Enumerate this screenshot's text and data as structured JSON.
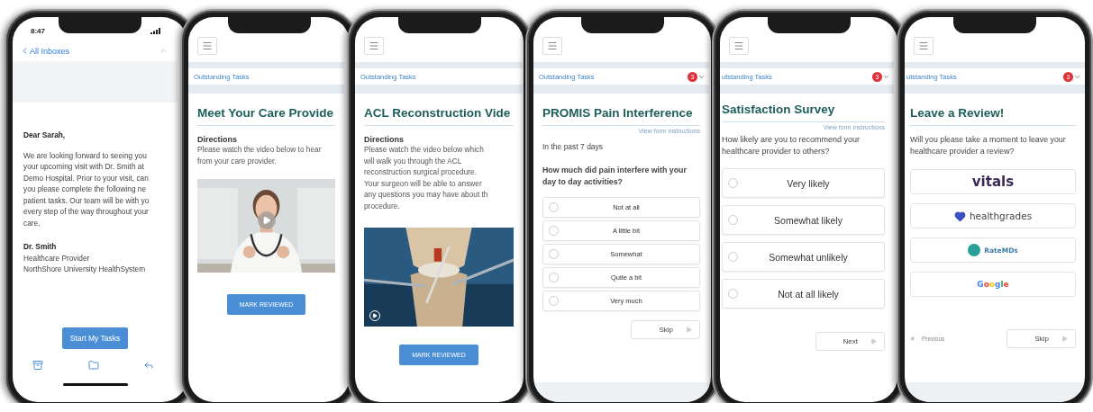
{
  "phones": [
    {
      "kind": "email",
      "status_time": "8:47",
      "back_label": "All Inboxes",
      "greeting": "Dear Sarah,",
      "body_lines": [
        "We are looking forward to seeing you",
        "your upcoming visit with Dr. Smith at",
        "Demo Hospital. Prior to your visit, can",
        "you please complete the following ne",
        "patient tasks. Our team will be with yo",
        "every step of the way throughout your",
        "care."
      ],
      "signature": [
        "Dr. Smith",
        "Healthcare Provider",
        "NorthShore University HealthSystem"
      ],
      "button": "Start My Tasks"
    },
    {
      "kind": "video",
      "breadcrumb": "Outstanding Tasks",
      "title": "Meet Your Care Provide",
      "directions_label": "Directions",
      "directions": [
        "Please watch the video below to hear",
        "from your care provider."
      ],
      "button": "MARK REVIEWED"
    },
    {
      "kind": "video",
      "breadcrumb": "Outstanding Tasks",
      "title": "ACL Reconstruction Vide",
      "directions_label": "Directions",
      "directions": [
        "Please watch the video below which",
        "will walk you through the ACL",
        "reconstruction surgical procedure.",
        "Your surgeon will be able to answer",
        "any questions you may have about th",
        "procedure."
      ],
      "button": "MARK REVIEWED"
    },
    {
      "kind": "survey",
      "breadcrumb": "Outstanding Tasks",
      "badge": "3",
      "title": "PROMIS Pain Interference",
      "instructions_link": "View form instructions",
      "subtitle": "In the past 7 days",
      "question": "How much did pain interfere with your day to day activities?",
      "options": [
        {
          "label": "Not at all",
          "selected": false
        },
        {
          "label": "A little bit",
          "selected": false
        },
        {
          "label": "Somewhat",
          "selected": false
        },
        {
          "label": "Quite a bit",
          "selected": false
        },
        {
          "label": "Very much",
          "selected": false
        }
      ],
      "next_button": "Skip"
    },
    {
      "kind": "rating",
      "breadcrumb": "utstanding Tasks",
      "badge": "3",
      "title": "Satisfaction Survey",
      "instructions_link": "View form instructions",
      "question": "How likely are you to recommend your healthcare provider to others?",
      "options": [
        {
          "label": "Very likely",
          "selected": false
        },
        {
          "label": "Somewhat likely",
          "selected": false
        },
        {
          "label": "Somewhat unlikely",
          "selected": false
        },
        {
          "label": "Not at all likely",
          "selected": false
        }
      ],
      "next_button": "Next"
    },
    {
      "kind": "review",
      "breadcrumb": "utstanding Tasks",
      "badge": "3",
      "title": "Leave a Review!",
      "prompt": "Will you please take a moment to leave your healthcare provider a review?",
      "sites": [
        {
          "kind": "vitals",
          "label": "vitals"
        },
        {
          "kind": "healthgrades",
          "label": "healthgrades"
        },
        {
          "kind": "ratemds",
          "label": "RateMDs"
        },
        {
          "kind": "google",
          "label": "Google"
        }
      ],
      "previous_button": "Previous",
      "next_button": "Skip"
    }
  ]
}
